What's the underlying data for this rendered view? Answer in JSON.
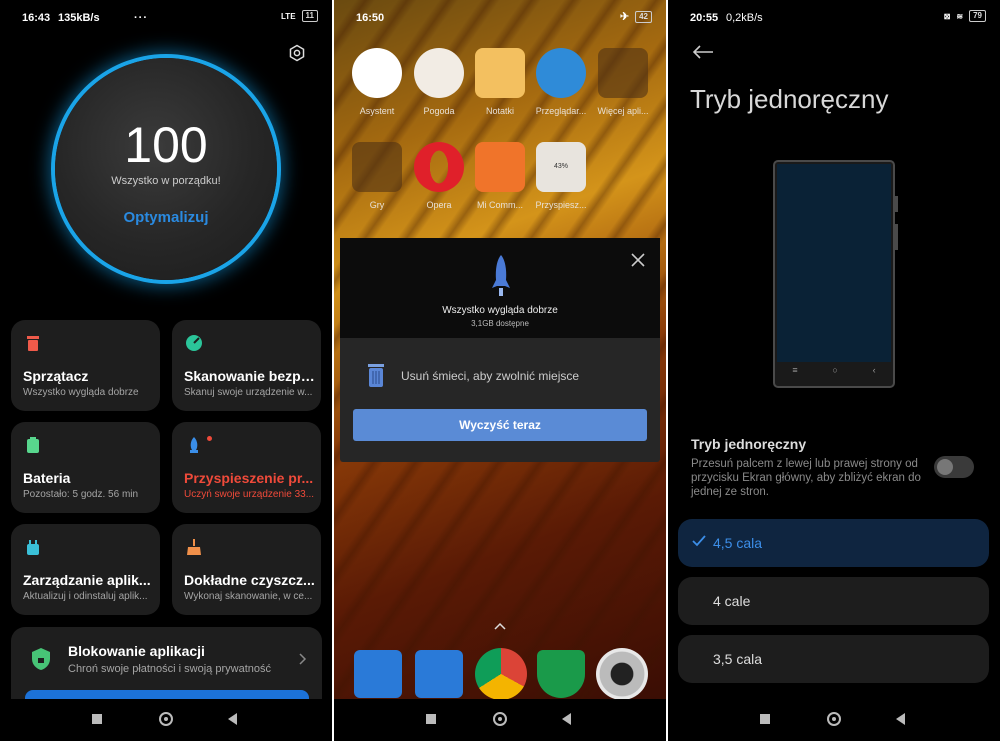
{
  "panel1": {
    "status": {
      "time": "16:43",
      "speed": "135kB/s",
      "dots": "···",
      "net": "LTE",
      "battery": "11"
    },
    "score": "100",
    "score_sub": "Wszystko w porządku!",
    "optimize": "Optymalizuj",
    "cards": [
      {
        "title": "Sprzątacz",
        "sub": "Wszystko wygląda dobrze",
        "icon": "trash-icon",
        "color": "#ef5a4a"
      },
      {
        "title": "Skanowanie bezpi...",
        "sub": "Skanuj swoje urządzenie w...",
        "icon": "shield-scan-icon",
        "color": "#2bc59a"
      },
      {
        "title": "Bateria",
        "sub": "Pozostało: 5 godz. 56 min",
        "icon": "battery-icon",
        "color": "#58d68d"
      },
      {
        "title": "Przyspieszenie pr...",
        "sub": "Uczyń swoje urządzenie 33...",
        "icon": "rocket-icon",
        "color": "#3a8ee8"
      },
      {
        "title": "Zarządzanie aplik...",
        "sub": "Aktualizuj i odinstaluj aplik...",
        "icon": "android-icon",
        "color": "#3ac0d8"
      },
      {
        "title": "Dokładne czyszcz...",
        "sub": "Wykonaj skanowanie, w ce...",
        "icon": "broom-icon",
        "color": "#f0904a"
      }
    ],
    "lock": {
      "title": "Blokowanie aplikacji",
      "sub": "Chroń swoje płatności i swoją prywatność"
    }
  },
  "panel2": {
    "status": {
      "time": "16:50",
      "battery": "42"
    },
    "apps_row1": [
      "Asystent",
      "Pogoda",
      "Notatki",
      "Przeglądar...",
      "Więcej apli..."
    ],
    "apps_row2": [
      "Gry",
      "Opera",
      "Mi Comm...",
      "Przyspiesz..."
    ],
    "boost_percent": "43%",
    "dialog": {
      "title": "Wszystko wygląda dobrze",
      "sub": "3,1GB dostępne",
      "message": "Usuń śmieci, aby zwolnić miejsce",
      "button": "Wyczyść teraz"
    }
  },
  "panel3": {
    "status": {
      "time": "20:55",
      "speed": "0,2kB/s",
      "battery": "79"
    },
    "title": "Tryb jednoręczny",
    "option_title": "Tryb jednoręczny",
    "option_desc": "Przesuń palcem z lewej lub prawej strony od przycisku Ekran główny, aby zbliżyć ekran do jednej ze stron.",
    "choices": [
      "4,5 cala",
      "4 cale",
      "3,5 cala"
    ],
    "selected": "4,5 cala"
  }
}
